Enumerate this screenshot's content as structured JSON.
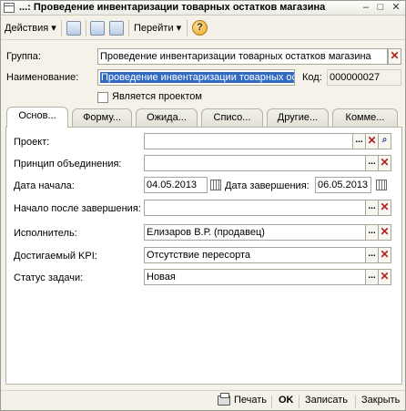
{
  "window": {
    "title": "...: Проведение инвентаризации товарных остатков магазина",
    "minimize": "–",
    "maximize": "□",
    "close": "✕"
  },
  "toolbar": {
    "actions_label": "Действия",
    "goto_label": "Перейти",
    "help_label": "?"
  },
  "header": {
    "group_label": "Группа:",
    "group_value": "Проведение инвентаризации товарных остатков магазина",
    "name_label": "Наименование:",
    "name_value": "Проведение инвентаризации товарных ос",
    "code_label": "Код:",
    "code_value": "000000027",
    "is_project_label": "Является проектом"
  },
  "tabs": [
    {
      "label": "Основ...",
      "active": true
    },
    {
      "label": "Форму...",
      "active": false
    },
    {
      "label": "Ожида...",
      "active": false
    },
    {
      "label": "Списо...",
      "active": false
    },
    {
      "label": "Другие...",
      "active": false
    },
    {
      "label": "Комме...",
      "active": false
    }
  ],
  "form": {
    "project_label": "Проект:",
    "project_value": "",
    "union_label": "Принцип объединения:",
    "union_value": "",
    "start_label": "Дата начала:",
    "start_value": "04.05.2013",
    "end_label": "Дата завершения:",
    "end_value": "06.05.2013",
    "after_label": "Начало после завершения:",
    "after_value": "",
    "executor_label": "Исполнитель:",
    "executor_value": "Елизаров В.Р. (продавец)",
    "kpi_label": "Достигаемый KPI:",
    "kpi_value": "Отсутствие пересорта",
    "status_label": "Статус задачи:",
    "status_value": "Новая"
  },
  "footer": {
    "print_label": "Печать",
    "ok_label": "OK",
    "save_label": "Записать",
    "close_label": "Закрыть"
  },
  "icons": {
    "select": "...",
    "clear": "✕",
    "search": "🔍"
  }
}
